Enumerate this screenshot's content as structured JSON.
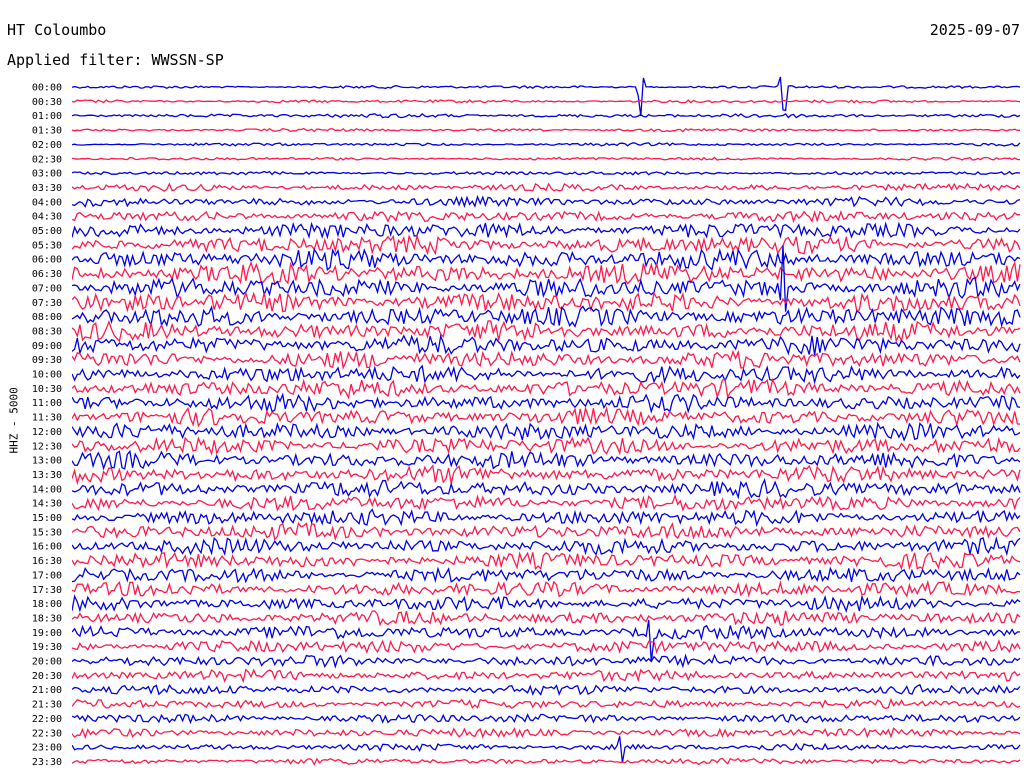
{
  "header": {
    "station": "HT Coloumbo",
    "date": "2025-09-07",
    "filter": "Applied filter: WWSSN-SP"
  },
  "colors": {
    "trace_a": "#0000e6",
    "trace_b": "#ff1a4d",
    "background": "#ffffff",
    "text": "#000000"
  },
  "chart_data": {
    "type": "line",
    "title": "HT Coloumbo",
    "ylabel": "HHZ - 5000",
    "xlabel": "",
    "grid": false,
    "legend": "none",
    "row_labels": [
      "00:00",
      "00:30",
      "01:00",
      "01:30",
      "02:00",
      "02:30",
      "03:00",
      "03:30",
      "04:00",
      "04:30",
      "05:00",
      "05:30",
      "06:00",
      "06:30",
      "07:00",
      "07:30",
      "08:00",
      "08:30",
      "09:00",
      "09:30",
      "10:00",
      "10:30",
      "11:00",
      "11:30",
      "12:00",
      "12:30",
      "13:00",
      "13:30",
      "14:00",
      "14:30",
      "15:00",
      "15:30",
      "16:00",
      "16:30",
      "17:00",
      "17:30",
      "18:00",
      "18:30",
      "19:00",
      "19:30",
      "20:00",
      "20:30",
      "21:00",
      "21:30",
      "22:00",
      "22:30",
      "23:00",
      "23:30"
    ],
    "row_colors": [
      "trace_a",
      "trace_b"
    ],
    "relative_amplitude": [
      0.3,
      0.3,
      0.4,
      0.3,
      0.3,
      0.3,
      0.35,
      0.7,
      0.9,
      1.1,
      1.6,
      1.8,
      2.0,
      2.1,
      2.0,
      2.0,
      2.0,
      1.9,
      1.9,
      1.8,
      1.8,
      1.8,
      1.7,
      1.7,
      1.7,
      1.7,
      1.7,
      1.7,
      1.7,
      1.6,
      1.6,
      1.6,
      1.6,
      1.6,
      1.5,
      1.5,
      1.4,
      1.4,
      1.4,
      1.3,
      1.2,
      1.1,
      1.0,
      0.9,
      0.9,
      0.9,
      0.7,
      0.6
    ],
    "events": [
      {
        "row": 0,
        "position": 0.6,
        "amplitude": 30
      },
      {
        "row": 0,
        "position": 0.75,
        "amplitude": 90
      },
      {
        "row": 14,
        "position": 0.75,
        "amplitude": 90
      },
      {
        "row": 38,
        "position": 0.61,
        "amplitude": 50
      },
      {
        "row": 46,
        "position": 0.58,
        "amplitude": 20
      }
    ]
  }
}
